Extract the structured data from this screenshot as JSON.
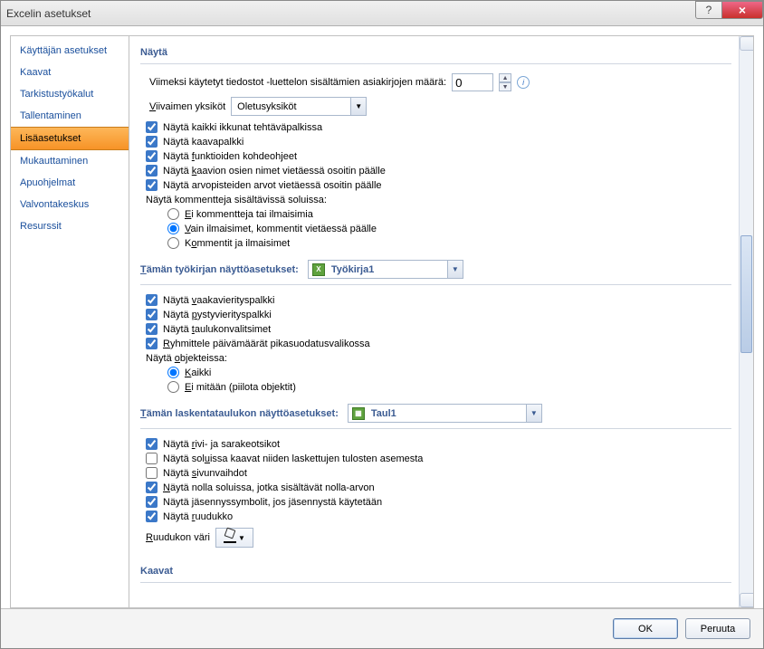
{
  "window": {
    "title": "Excelin asetukset"
  },
  "sidebar": {
    "items": [
      {
        "label": "Käyttäjän asetukset"
      },
      {
        "label": "Kaavat"
      },
      {
        "label": "Tarkistustyökalut"
      },
      {
        "label": "Tallentaminen"
      },
      {
        "label": "Lisäasetukset",
        "selected": true
      },
      {
        "label": "Mukauttaminen"
      },
      {
        "label": "Apuohjelmat"
      },
      {
        "label": "Valvontakeskus"
      },
      {
        "label": "Resurssit"
      }
    ]
  },
  "display": {
    "header": "Näytä",
    "recent_label": "Viimeksi käytetyt tiedostot -luettelon sisältämien asiakirjojen määrä:",
    "recent_value": "0",
    "ruler_label": "Viivaimen yksiköt",
    "ruler_value": "Oletusyksiköt",
    "chk_windows": "Näytä kaikki ikkunat tehtäväpalkissa",
    "chk_formula": "Näytä kaavapalkki",
    "chk_funcs": "Näytä funktioiden kohdeohjeet",
    "chk_chart": "Näytä kaavion osien nimet vietäessä osoitin päälle",
    "chk_values": "Näytä arvopisteiden arvot vietäessä osoitin päälle",
    "comments_label": "Näytä kommentteja sisältävissä soluissa:",
    "r_none": "Ei kommentteja tai ilmaisimia",
    "r_ind": "Vain ilmaisimet, kommentit vietäessä päälle",
    "r_both": "Kommentit ja ilmaisimet"
  },
  "workbook": {
    "header": "Tämän työkirjan näyttöasetukset:",
    "value": "Työkirja1",
    "chk_hscroll": "Näytä vaakavierityspalkki",
    "chk_vscroll": "Näytä pystyvierityspalkki",
    "chk_tabs": "Näytä taulukonvalitsimet",
    "chk_groupdates": "Ryhmittele päivämäärät pikasuodatusvalikossa",
    "objects_label": "Näytä objekteissa:",
    "r_all": "Kaikki",
    "r_none": "Ei mitään (piilota objektit)"
  },
  "worksheet": {
    "header": "Tämän laskentataulukon näyttöasetukset:",
    "value": "Taul1",
    "chk_headers": "Näytä rivi- ja sarakeotsikot",
    "chk_formulas": "Näytä soluissa kaavat niiden laskettujen tulosten asemesta",
    "chk_breaks": "Näytä sivunvaihdot",
    "chk_zeros": "Näytä nolla soluissa, jotka sisältävät nolla-arvon",
    "chk_outline": "Näytä jäsennyssymbolit, jos jäsennystä käytetään",
    "chk_grid": "Näytä ruudukko",
    "gridcolor_label": "Ruudukon väri"
  },
  "next_section": "Kaavat",
  "footer": {
    "ok": "OK",
    "cancel": "Peruuta"
  },
  "und": {
    "ruler": "V",
    "funcs": "f",
    "chart": "k",
    "comments_r": "E",
    "comments_i": "V",
    "comments_b": "K",
    "wb": "T",
    "hscroll": "v",
    "vscroll": "p",
    "tabs": "t",
    "group": "R",
    "obj": "o",
    "rall": "K",
    "rnone": "E",
    "ws": "T",
    "head": "r",
    "form": "u",
    "breaks": "s",
    "zero": "N",
    "outl": "j",
    "grid": "r",
    "gcol": "R"
  }
}
